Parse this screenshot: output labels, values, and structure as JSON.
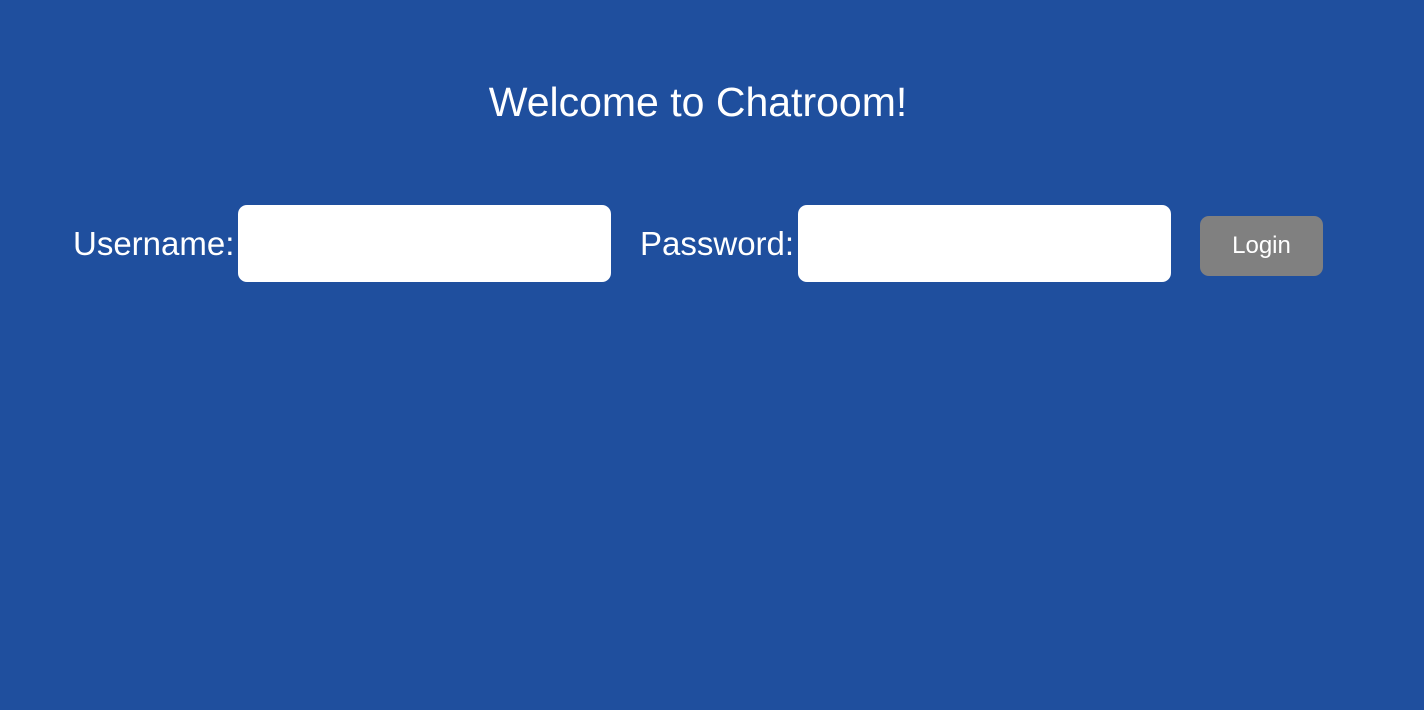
{
  "page": {
    "title": "Welcome to Chatroom!",
    "background_color": "#1f4f9e"
  },
  "login_form": {
    "username_label": "Username:",
    "username_value": "",
    "password_label": "Password:",
    "password_value": "",
    "login_button_label": "Login",
    "login_button_color": "#808080"
  }
}
